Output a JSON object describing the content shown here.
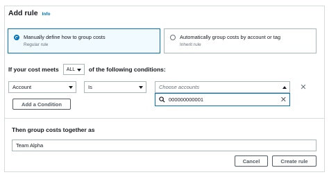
{
  "header": {
    "title": "Add rule",
    "info_link": "Info"
  },
  "grouping_options": [
    {
      "label": "Manually define how to group costs",
      "sublabel": "Regular rule",
      "selected": true
    },
    {
      "label": "Automatically group costs by account or tag",
      "sublabel": "Inherit rule",
      "selected": false
    }
  ],
  "conditions_sentence": {
    "prefix": "If your cost meets",
    "match_value": "ALL",
    "suffix": "of the following conditions:"
  },
  "condition": {
    "field": "Account",
    "operator": "Is",
    "value_placeholder": "Choose accounts",
    "search_value": "000000000001"
  },
  "add_condition_label": "Add a Condition",
  "group_section": {
    "label": "Then group costs together as",
    "value": "Team Alpha"
  },
  "footer": {
    "cancel_label": "Cancel",
    "create_label": "Create rule"
  },
  "colors": {
    "accent": "#0073bb",
    "border": "#aab7b8",
    "selected_bg": "#f1faff"
  },
  "icons": {
    "radio_selected": "radio-selected-icon",
    "dropdown": "caret-down-icon",
    "search": "search-icon",
    "clear": "clear-icon",
    "remove": "remove-icon"
  }
}
